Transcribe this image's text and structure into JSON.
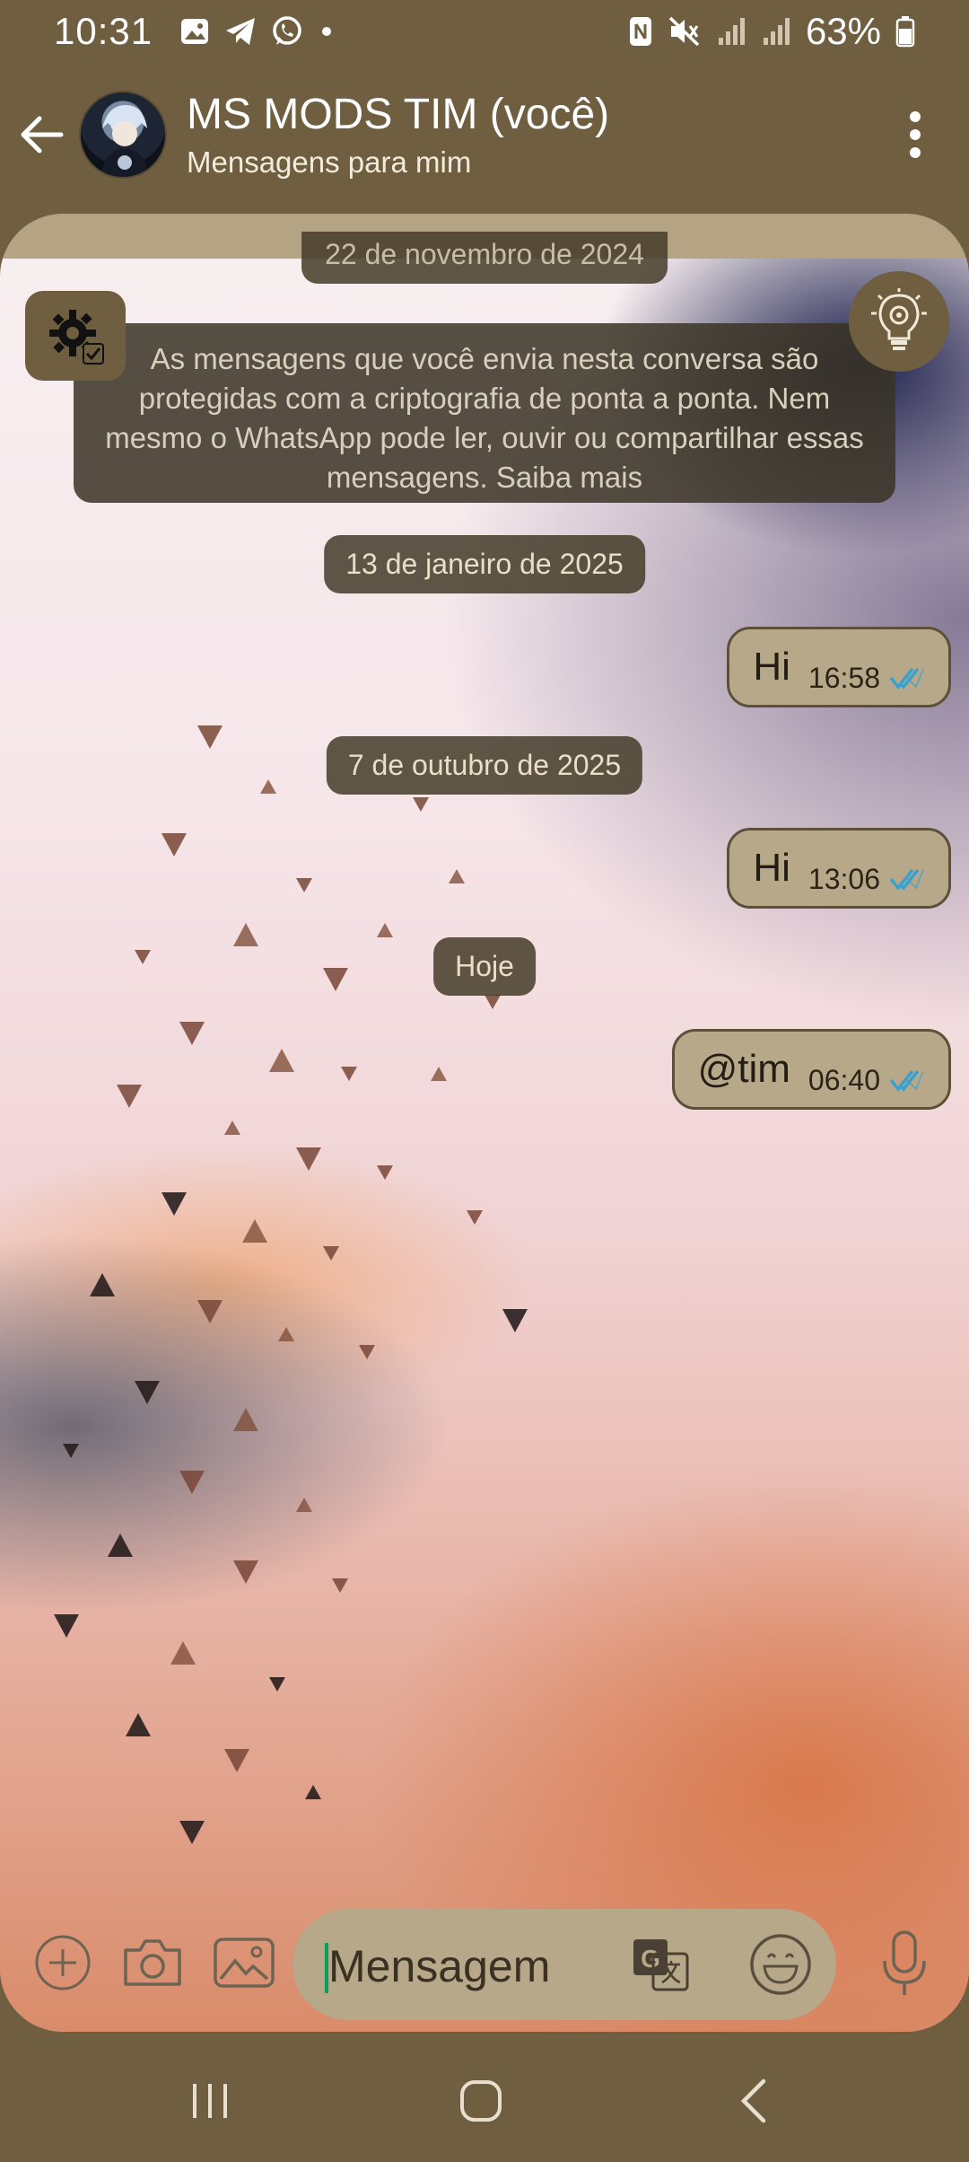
{
  "status_bar": {
    "time": "10:31",
    "battery": "63%",
    "left_icons": [
      "gallery-icon",
      "telegram-icon",
      "whatsapp-icon",
      "dot-icon"
    ],
    "right_icons": [
      "nfc-icon",
      "mute-icon",
      "signal-icon",
      "signal-icon",
      "battery-icon"
    ]
  },
  "header": {
    "contact_name": "MS MODS TIM (você)",
    "contact_status": "Mensagens para mim"
  },
  "chat": {
    "date_chip_top": "22 de novembro de 2024",
    "encryption_notice": "As mensagens que você envia nesta conversa são protegidas com a criptografia de ponta a ponta. Nem mesmo o WhatsApp pode ler, ouvir ou compartilhar essas mensagens. Saiba mais",
    "groups": [
      {
        "date": "13 de janeiro de 2025",
        "message": {
          "text": "Hi",
          "time": "16:58",
          "status": "read"
        }
      },
      {
        "date": "7 de outubro de 2025",
        "message": {
          "text": "Hi",
          "time": "13:06",
          "status": "read"
        }
      },
      {
        "date": "Hoje",
        "message": {
          "text": "@tim",
          "time": "06:40",
          "status": "read"
        }
      }
    ]
  },
  "input": {
    "placeholder": "Mensagem"
  },
  "colors": {
    "theme": "#6f5f40",
    "bubble": "#b7a88a",
    "read_ticks": "#3aa0d0",
    "cursor": "#0a9e5a"
  }
}
